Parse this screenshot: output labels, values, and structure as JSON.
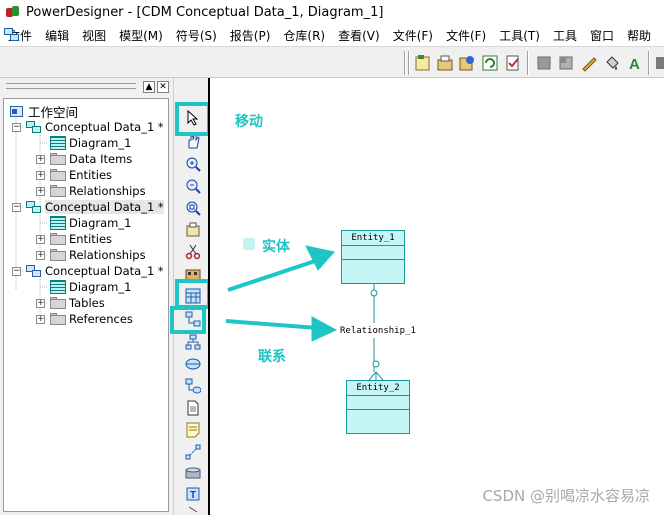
{
  "window": {
    "title": "PowerDesigner - [CDM Conceptual Data_1, Diagram_1]"
  },
  "menubar": {
    "items": [
      "文件",
      "编辑",
      "视图",
      "模型(M)",
      "符号(S)",
      "报告(P)",
      "仓库(R)",
      "查看(V)",
      "文件(F)",
      "文件(F)",
      "工具(T)",
      "工具",
      "窗口",
      "帮助"
    ]
  },
  "toolbar": {
    "icons": [
      "new-model-icon",
      "package-icon",
      "properties-icon",
      "refresh-icon",
      "check-model-icon",
      "grey-box-icon",
      "grey-box2-icon",
      "pen-icon",
      "fill-icon",
      "text-style-icon",
      "more-icon"
    ]
  },
  "sidebar": {
    "header_buttons": [
      "▲",
      "✕"
    ],
    "tree": [
      {
        "label": "工作空间",
        "icon": "workspace-icon",
        "level": 0
      },
      {
        "label": "Conceptual Data_1 *",
        "icon": "model-icon",
        "level": 1,
        "expander": "−"
      },
      {
        "label": "Diagram_1",
        "icon": "diagram-icon",
        "level": 2
      },
      {
        "label": "Data Items",
        "icon": "folder-icon",
        "level": 2,
        "expander": "+"
      },
      {
        "label": "Entities",
        "icon": "folder-icon",
        "level": 2,
        "expander": "+"
      },
      {
        "label": "Relationships",
        "icon": "folder-icon",
        "level": 2,
        "expander": "+"
      },
      {
        "label": "Conceptual Data_1 *",
        "icon": "model-icon",
        "level": 1,
        "expander": "−",
        "selected": true
      },
      {
        "label": "Diagram_1",
        "icon": "diagram-icon",
        "level": 2
      },
      {
        "label": "Entities",
        "icon": "folder-icon",
        "level": 2,
        "expander": "+"
      },
      {
        "label": "Relationships",
        "icon": "folder-icon",
        "level": 2,
        "expander": "+"
      },
      {
        "label": "Conceptual Data_1 *",
        "icon": "pdm-model-icon",
        "level": 1,
        "expander": "−"
      },
      {
        "label": "Diagram_1",
        "icon": "diagram-icon",
        "level": 2
      },
      {
        "label": "Tables",
        "icon": "folder-icon",
        "level": 2,
        "expander": "+"
      },
      {
        "label": "References",
        "icon": "folder-icon",
        "level": 2,
        "expander": "+"
      }
    ]
  },
  "palette": {
    "tools": [
      "pointer-icon",
      "hand-icon",
      "zoom-in-icon",
      "zoom-out-icon",
      "zoom-fit-icon",
      "properties-icon",
      "cut-icon",
      "package-icon",
      "entity-tool-icon",
      "relationship-tool-icon",
      "inheritance-icon",
      "association-icon",
      "association-link-icon",
      "file-icon",
      "note-icon",
      "link-icon",
      "cylinder-icon",
      "text-icon",
      "more-icon"
    ]
  },
  "canvas": {
    "annotations": {
      "move": "移动",
      "entity": "实体",
      "relationship": "联系"
    },
    "entities": [
      {
        "name": "Entity_1"
      },
      {
        "name": "Entity_2"
      }
    ],
    "relationship": {
      "name": "Relationship_1"
    },
    "colors": {
      "annotation": "#1fc4c4",
      "entity_fill": "#c6f5f5",
      "entity_border": "#139a9a"
    }
  },
  "watermark": "CSDN @别喝凉水容易凉"
}
